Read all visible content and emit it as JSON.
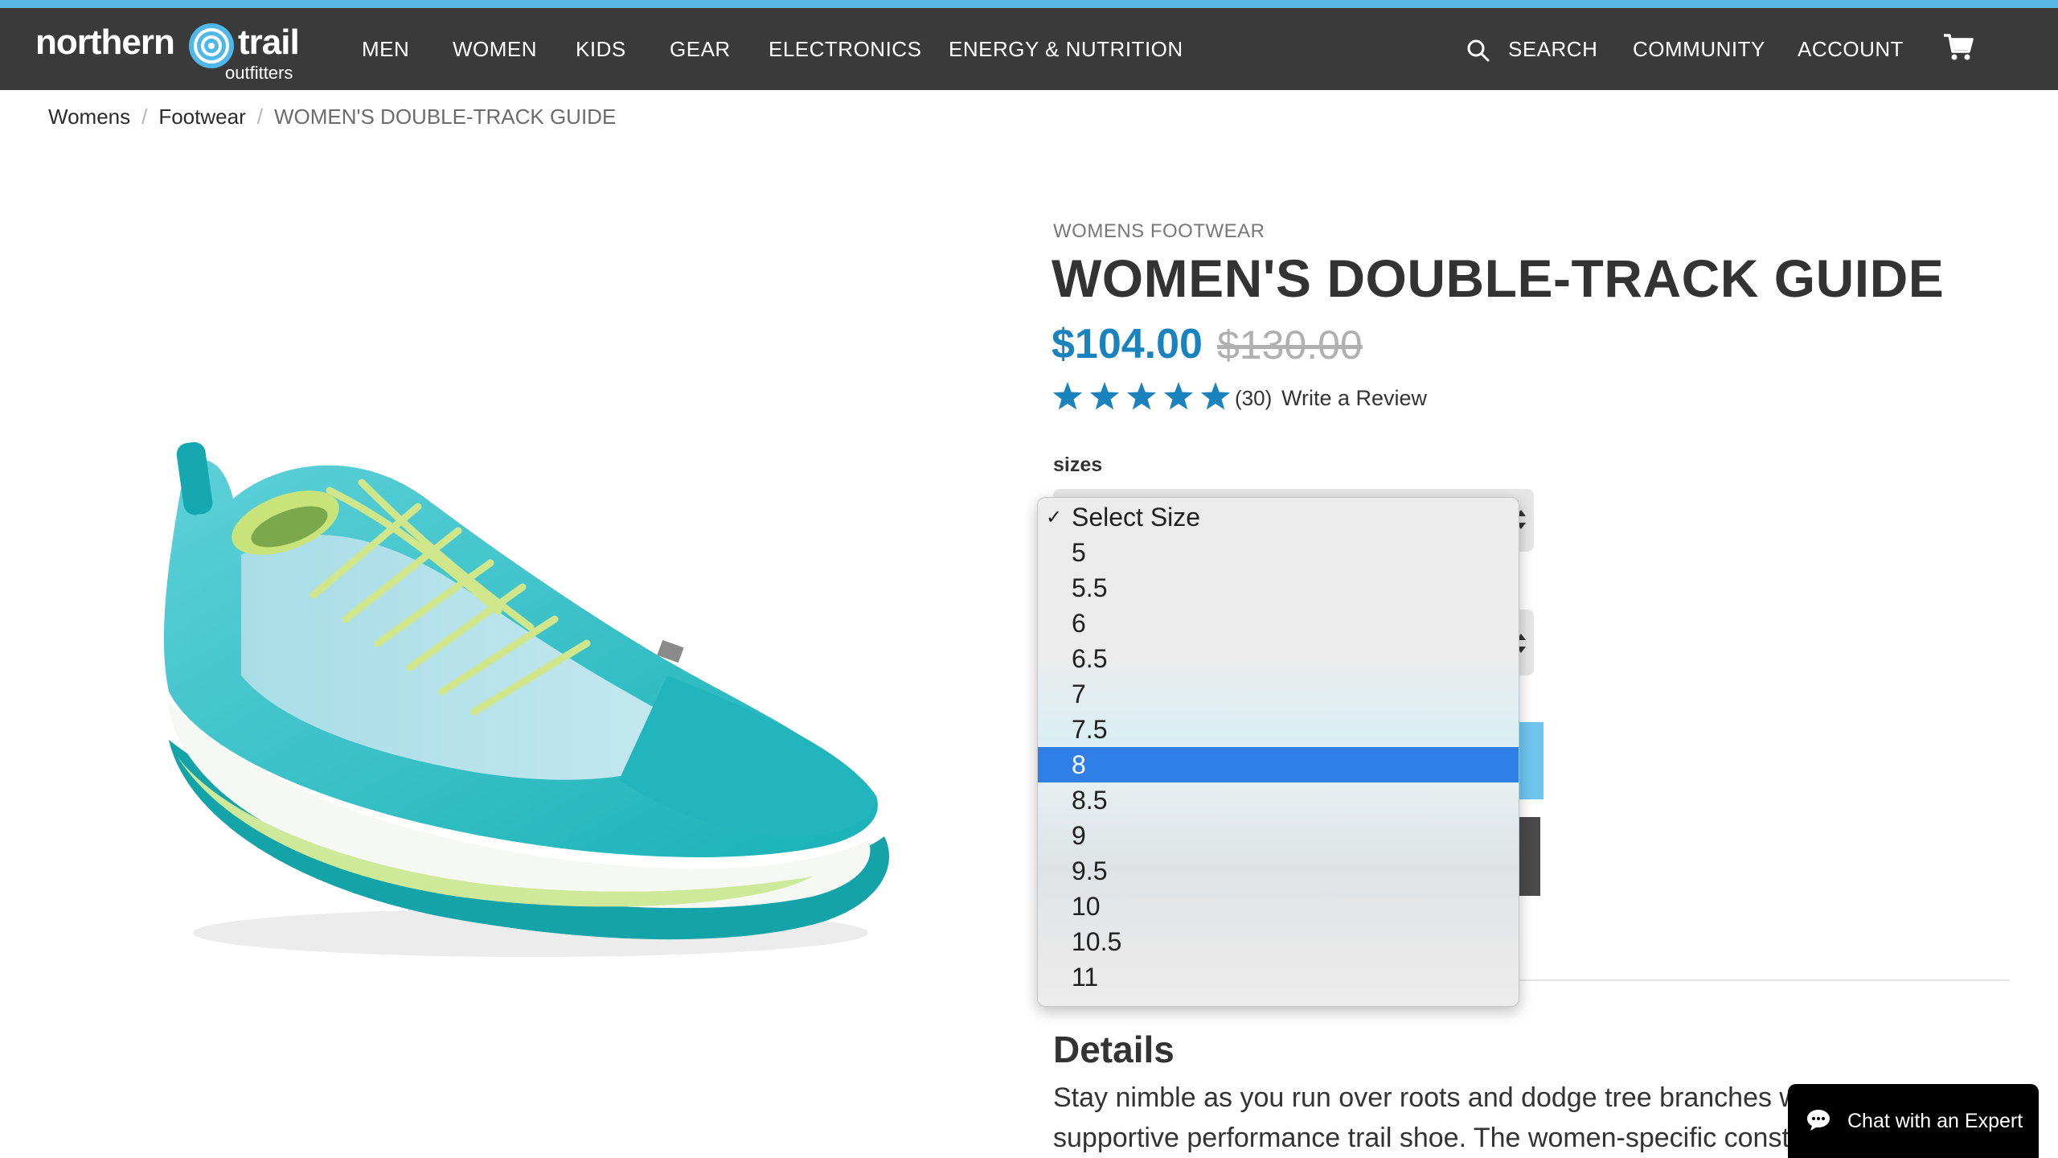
{
  "header": {
    "logo_word_left": "northern",
    "logo_word_right": "trail",
    "logo_sub": "outfitters",
    "nav": [
      "MEN",
      "WOMEN",
      "KIDS",
      "GEAR",
      "ELECTRONICS",
      "ENERGY & NUTRITION"
    ],
    "search_label": "SEARCH",
    "community_label": "COMMUNITY",
    "account_label": "ACCOUNT",
    "icons": {
      "search": "search-icon",
      "cart": "cart-icon"
    }
  },
  "breadcrumb": [
    "Womens",
    "Footwear",
    "WOMEN'S DOUBLE-TRACK GUIDE"
  ],
  "breadcrumb_sep": "/",
  "product": {
    "category": "WOMENS FOOTWEAR",
    "title": "WOMEN'S DOUBLE-TRACK GUIDE",
    "price": "$104.00",
    "original_price": "$130.00",
    "rating": 5,
    "review_count": "(30)",
    "write_review": "Write a Review",
    "sizes_label": "sizes",
    "accent_color": "#1a83bd"
  },
  "size_dropdown": {
    "options": [
      "Select Size",
      "5",
      "5.5",
      "6",
      "6.5",
      "7",
      "7.5",
      "8",
      "8.5",
      "9",
      "9.5",
      "10",
      "10.5",
      "11"
    ],
    "checked": "Select Size",
    "highlighted": "8",
    "highlight_color": "#2f7fe6"
  },
  "details": {
    "heading": "Details",
    "line1": "Stay nimble as you run over roots and dodge tree branches w",
    "line2": "supportive performance trail shoe. The women-specific const"
  },
  "chat": {
    "label": "Chat with an Expert",
    "icon": "chat-bubble-icon"
  }
}
